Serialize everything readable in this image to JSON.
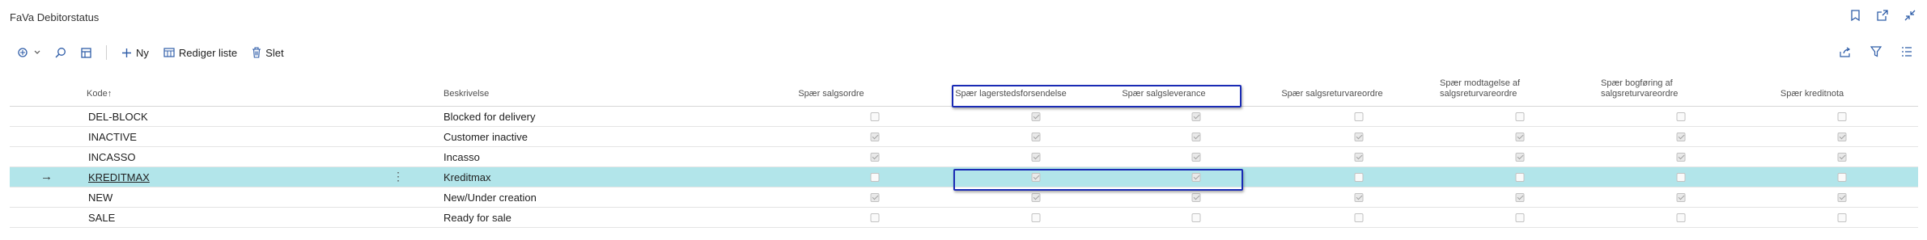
{
  "page": {
    "title": "FaVa Debitorstatus"
  },
  "toolbar": {
    "new_label": "Ny",
    "edit_list_label": "Rediger liste",
    "delete_label": "Slet"
  },
  "columns": {
    "code": "Kode",
    "sort_indicator": "↑",
    "description": "Beskrivelse",
    "col1": "Spær salgsordre",
    "col2": "Spær lagerstedsforsendelse",
    "col3": "Spær salgsleverance",
    "col4": "Spær salgsreturvareordre",
    "col5_line1": "Spær modtagelse af",
    "col5_line2": "salgsreturvareordre",
    "col6_line1": "Spær bogføring af",
    "col6_line2": "salgsreturvareordre",
    "col7": "Spær kreditnota"
  },
  "rows": [
    {
      "code": "DEL-BLOCK",
      "description": "Blocked for delivery",
      "checks": [
        false,
        true,
        true,
        false,
        false,
        false,
        false
      ]
    },
    {
      "code": "INACTIVE",
      "description": "Customer inactive",
      "checks": [
        true,
        true,
        true,
        true,
        true,
        true,
        true
      ]
    },
    {
      "code": "INCASSO",
      "description": "Incasso",
      "checks": [
        true,
        true,
        true,
        true,
        true,
        true,
        true
      ]
    },
    {
      "code": "KREDITMAX",
      "description": "Kreditmax",
      "checks": [
        false,
        true,
        true,
        false,
        false,
        false,
        false
      ]
    },
    {
      "code": "NEW",
      "description": "New/Under creation",
      "checks": [
        true,
        true,
        true,
        true,
        true,
        true,
        true
      ]
    },
    {
      "code": "SALE",
      "description": "Ready for sale",
      "checks": [
        false,
        false,
        false,
        false,
        false,
        false,
        false
      ]
    }
  ],
  "selected_row": 3,
  "colors": {
    "selected_row": "#b2e5ea",
    "highlight_border": "#1a2bb5",
    "accent": "#2f5da8"
  }
}
